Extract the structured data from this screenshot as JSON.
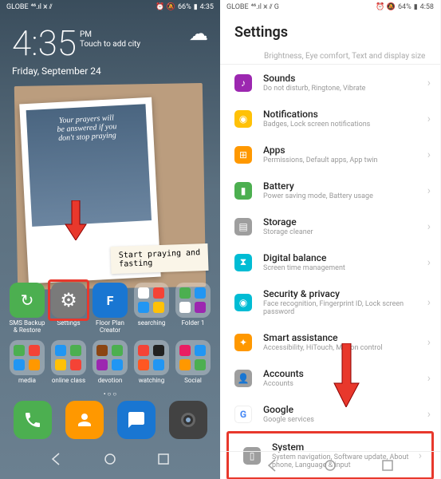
{
  "left_phone": {
    "status": {
      "carrier": "GLOBE",
      "signal": "⁴⁶.ıl",
      "wifi": "⩙",
      "vib": "⫽",
      "alarm": "⏰",
      "no_ring": "🔕",
      "battery_pct": "66%",
      "time": "4:35"
    },
    "clock": {
      "time": "4:35",
      "ampm": "PM",
      "touch": "Touch to add city",
      "date": "Friday, September 24",
      "weather": "☁"
    },
    "photo": {
      "script_line1": "Your prayers will",
      "script_line2": "be answered if you",
      "script_line3": "don't stop praying",
      "note_line1": "Start praying and",
      "note_line2": "fasting"
    },
    "apps_row1": [
      {
        "label": "SMS Backup & Restore",
        "color": "#4caf50",
        "icon": "↻",
        "highlighted": false
      },
      {
        "label": "Settings",
        "color": "#9e9e9e",
        "icon": "⚙",
        "highlighted": true
      },
      {
        "label": "Floor Plan Creator",
        "color": "#1976d2",
        "icon": "F",
        "highlighted": false
      },
      {
        "label": "searching",
        "folder": true,
        "highlighted": false
      },
      {
        "label": "Folder 1",
        "folder": true,
        "highlighted": false
      }
    ],
    "apps_row2": [
      {
        "label": "media",
        "folder": true
      },
      {
        "label": "online class",
        "folder": true
      },
      {
        "label": "devotion",
        "folder": true
      },
      {
        "label": "watching",
        "folder": true
      },
      {
        "label": "Social",
        "folder": true
      }
    ],
    "dock": [
      {
        "color": "#4caf50",
        "icon": "phone"
      },
      {
        "color": "#ff9800",
        "icon": "contacts"
      },
      {
        "color": "#1976d2",
        "icon": "messages"
      },
      {
        "color": "#424242",
        "icon": "camera"
      }
    ],
    "dots": "• ○ ○"
  },
  "right_phone": {
    "status": {
      "carrier": "GLOBE",
      "signal": "⁴⁶.ıl",
      "wifi": "⩙",
      "vib": "⫽",
      "g": "G",
      "alarm": "⏰",
      "no_ring": "🔕",
      "battery_pct": "64%",
      "time": "4:58"
    },
    "title": "Settings",
    "cut_text": "Brightness, Eye comfort, Text and display size",
    "items": [
      {
        "title": "Sounds",
        "sub": "Do not disturb, Ringtone, Vibrate",
        "color": "#9c27b0",
        "icon": "♪"
      },
      {
        "title": "Notifications",
        "sub": "Badges, Lock screen notifications",
        "color": "#ffc107",
        "icon": "◉"
      },
      {
        "title": "Apps",
        "sub": "Permissions, Default apps, App twin",
        "color": "#ff9800",
        "icon": "⊞"
      },
      {
        "title": "Battery",
        "sub": "Power saving mode, Battery usage",
        "color": "#4caf50",
        "icon": "▮"
      },
      {
        "title": "Storage",
        "sub": "Storage cleaner",
        "color": "#9e9e9e",
        "icon": "▤"
      },
      {
        "title": "Digital balance",
        "sub": "Screen time management",
        "color": "#00bcd4",
        "icon": "⧗"
      },
      {
        "title": "Security & privacy",
        "sub": "Face recognition, Fingerprint ID, Lock screen password",
        "color": "#00bcd4",
        "icon": "◉"
      },
      {
        "title": "Smart assistance",
        "sub": "Accessibility, HiTouch, Motion control",
        "color": "#ff9800",
        "icon": "✦"
      },
      {
        "title": "Accounts",
        "sub": "Accounts",
        "color": "#9e9e9e",
        "icon": "👤"
      },
      {
        "title": "Google",
        "sub": "Google services",
        "color": "#fff",
        "icon": "G"
      },
      {
        "title": "System",
        "sub": "System navigation, Software update, About phone, Language & input",
        "color": "#9e9e9e",
        "icon": "▯",
        "highlighted": true
      }
    ]
  }
}
